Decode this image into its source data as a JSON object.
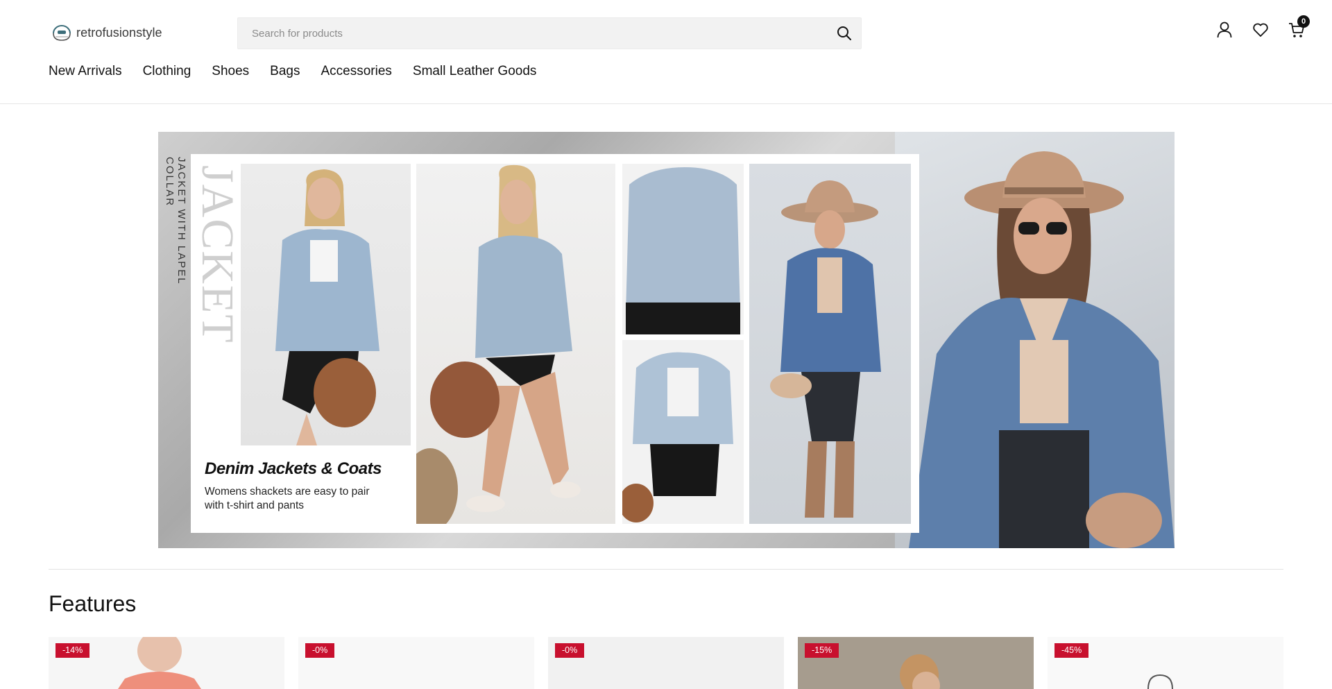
{
  "header": {
    "logo_text": "retrofusionstyle",
    "search": {
      "placeholder": "Search for products",
      "value": ""
    },
    "cart_count": "0"
  },
  "nav": {
    "items": [
      {
        "label": "New Arrivals"
      },
      {
        "label": "Clothing"
      },
      {
        "label": "Shoes"
      },
      {
        "label": "Bags"
      },
      {
        "label": "Accessories"
      },
      {
        "label": "Small Leather Goods"
      }
    ]
  },
  "hero": {
    "vertical_caption": "JACKET WITH LAPEL COLLAR",
    "vertical_title": "JACKET",
    "title": "Denim Jackets & Coats",
    "description": "Womens shackets are easy to pair with t-shirt and pants"
  },
  "features": {
    "title": "Features",
    "products": [
      {
        "discount": "-14%"
      },
      {
        "discount": "-0%"
      },
      {
        "discount": "-0%"
      },
      {
        "discount": "-15%"
      },
      {
        "discount": "-45%"
      }
    ]
  },
  "colors": {
    "accent": "#c8102e",
    "text": "#111111",
    "search_bg": "#f2f2f2"
  },
  "icons": [
    "search-icon",
    "user-icon",
    "heart-icon",
    "cart-icon",
    "logo-icon"
  ]
}
